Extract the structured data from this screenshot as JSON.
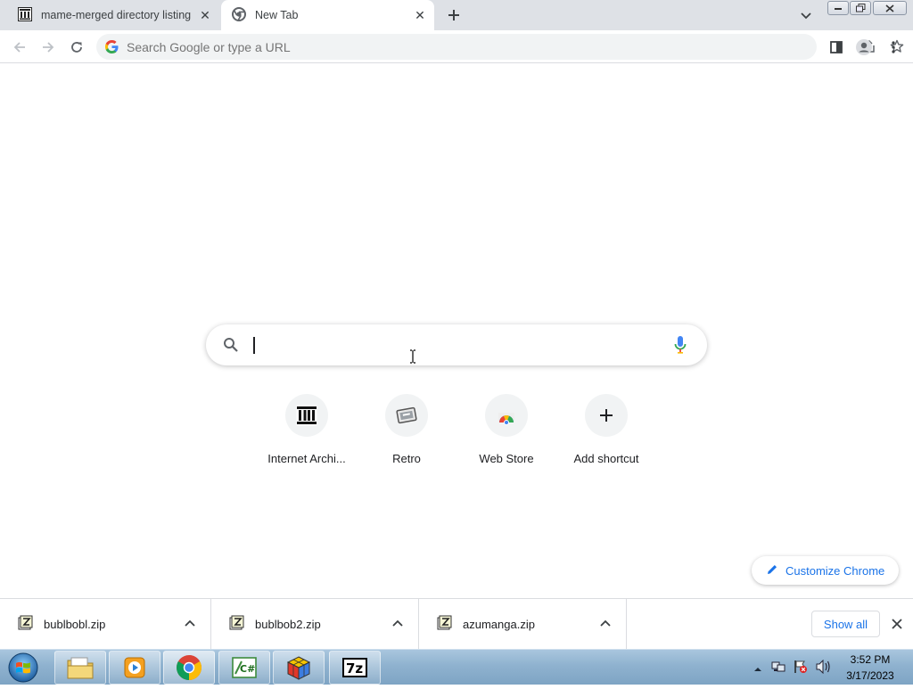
{
  "tabs": [
    {
      "title": "mame-merged directory listing",
      "favicon": "archive-icon",
      "active": false
    },
    {
      "title": "New Tab",
      "favicon": "chrome-icon",
      "active": true
    }
  ],
  "omnibox": {
    "placeholder": "Search Google or type a URL"
  },
  "shortcuts": [
    {
      "label": "Internet Archi...",
      "icon": "archive-icon"
    },
    {
      "label": "Retro",
      "icon": "retro-icon"
    },
    {
      "label": "Web Store",
      "icon": "web-store-icon"
    },
    {
      "label": "Add shortcut",
      "icon": "plus-icon"
    }
  ],
  "customize": {
    "label": "Customize Chrome"
  },
  "downloads": [
    {
      "name": "bublbobl.zip"
    },
    {
      "name": "bublbob2.zip"
    },
    {
      "name": "azumanga.zip"
    }
  ],
  "shelf": {
    "show_all": "Show all"
  },
  "taskbar": {
    "apps": [
      "explorer-icon",
      "media-player-icon",
      "chrome-icon",
      "csharp-icon",
      "cube-icon",
      "7zip-icon"
    ],
    "time": "3:52 PM",
    "date": "3/17/2023"
  },
  "colors": {
    "accent": "#1a73e8",
    "tabstrip": "#dee1e6",
    "omnibox": "#f1f3f4"
  }
}
